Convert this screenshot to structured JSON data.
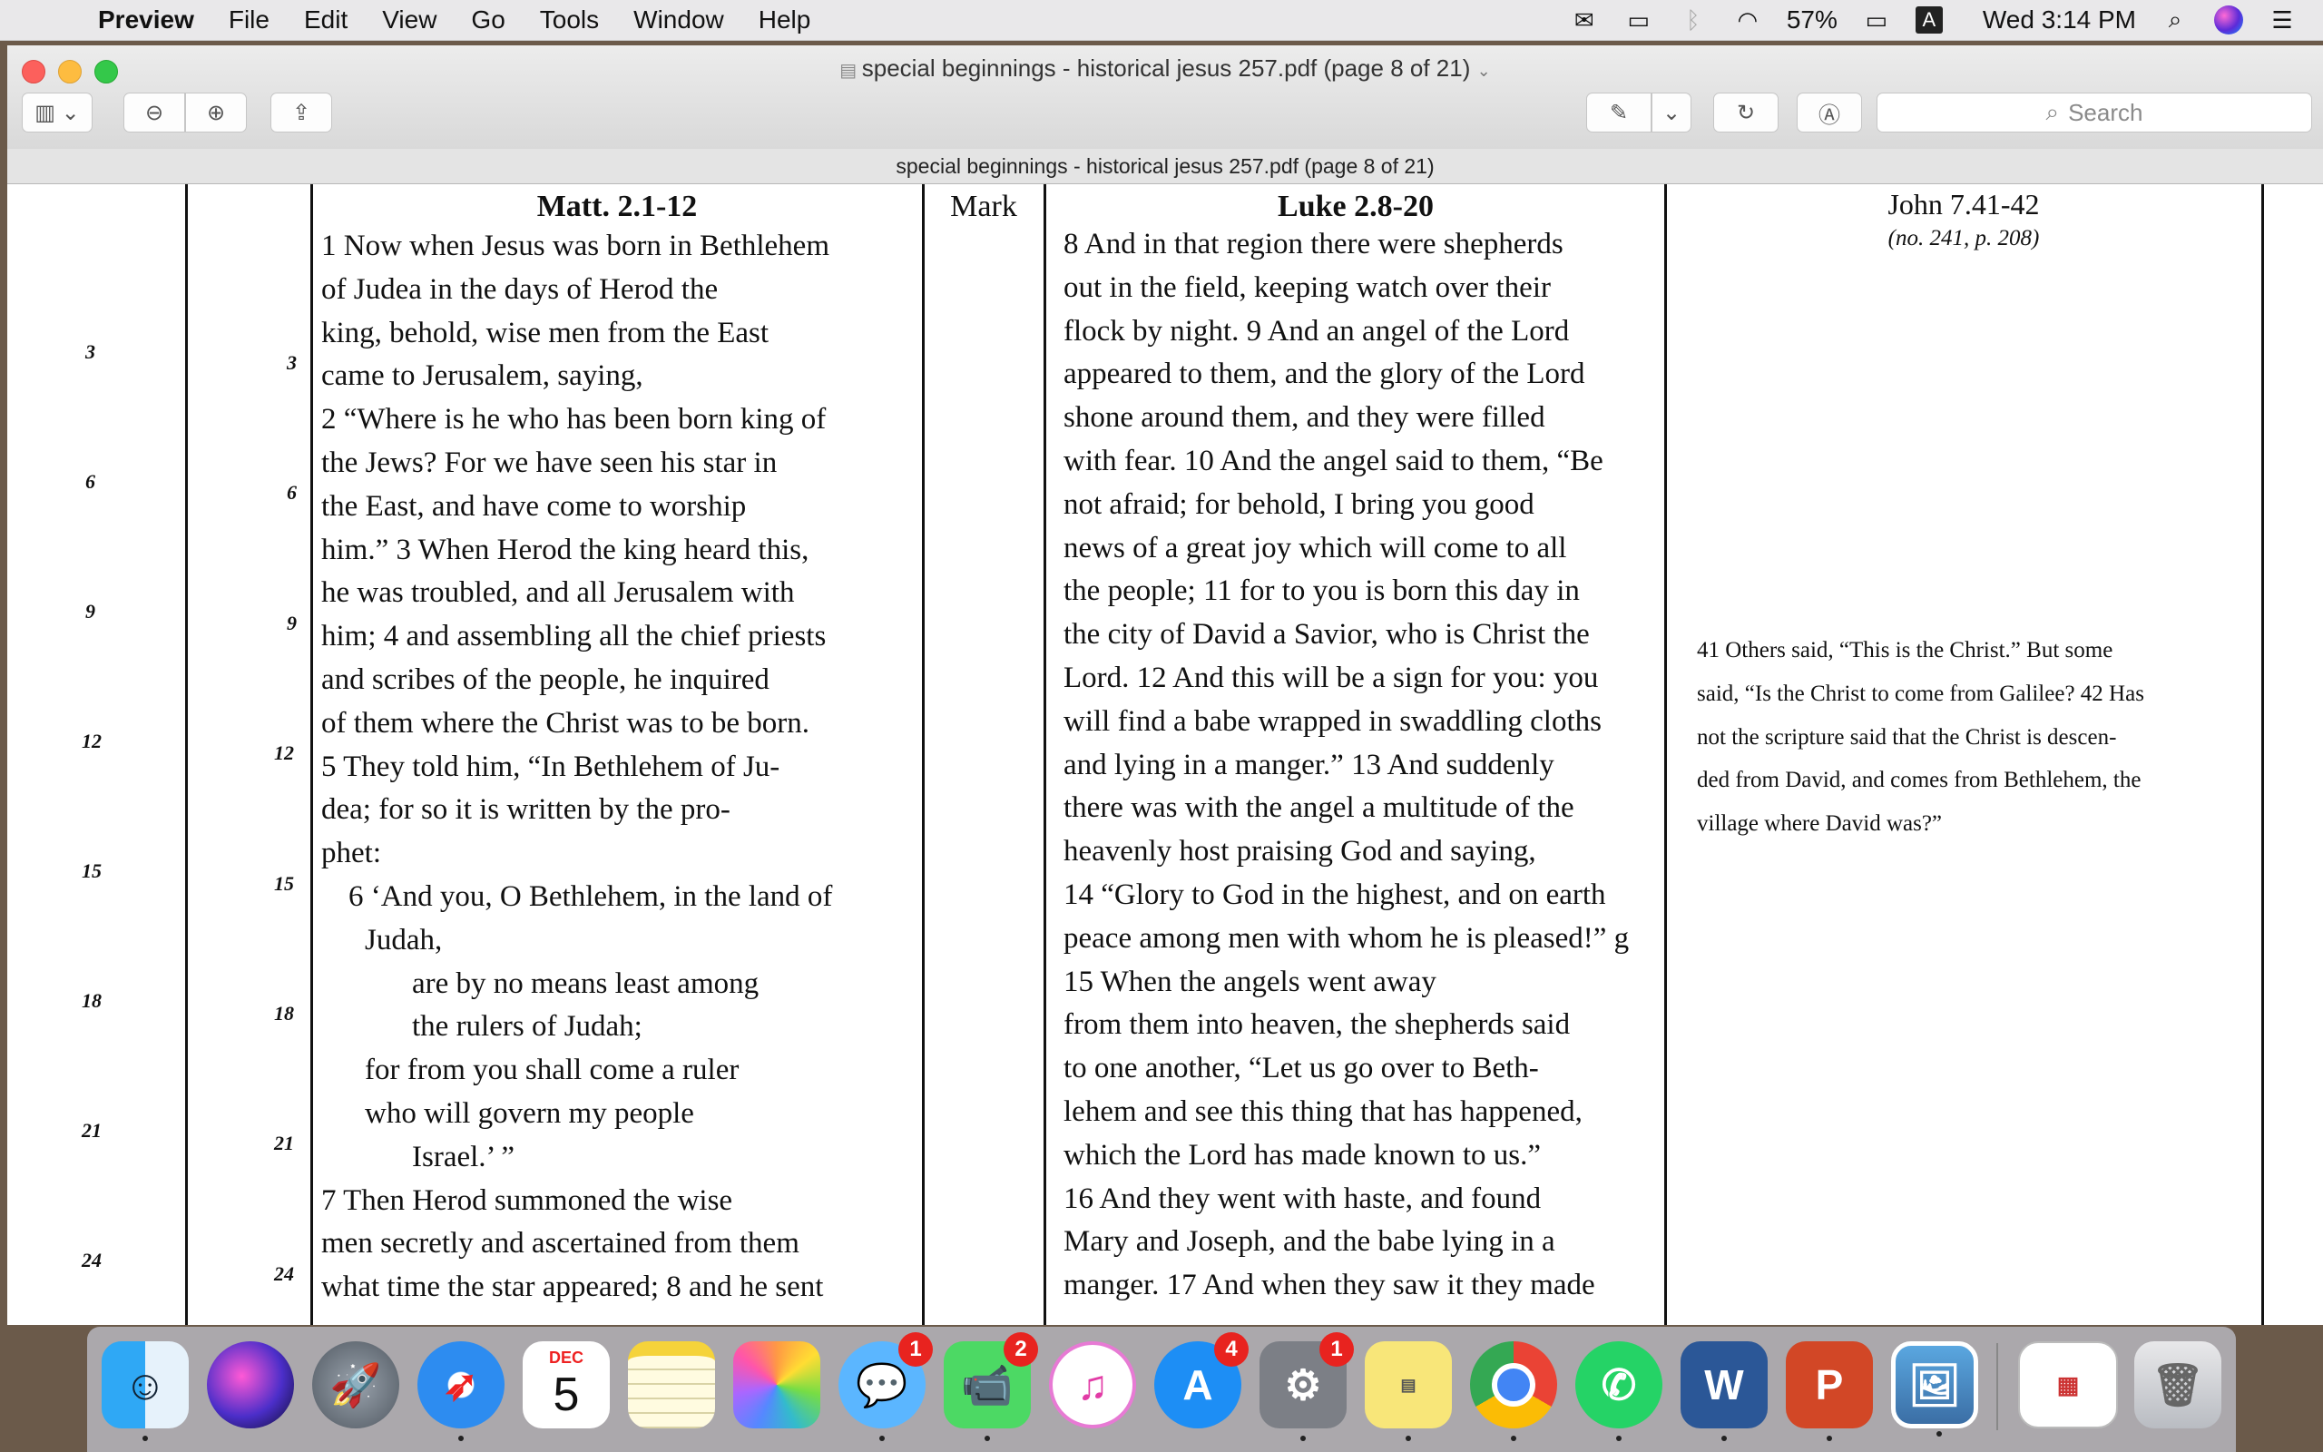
{
  "menubar": {
    "app": "Preview",
    "items": [
      "File",
      "Edit",
      "View",
      "Go",
      "Tools",
      "Window",
      "Help"
    ],
    "battery": "57%",
    "input_source": "A",
    "clock": "Wed 3:14 PM"
  },
  "window": {
    "title": "special beginnings - historical jesus 257.pdf (page 8 of 21)",
    "search_placeholder": "Search",
    "doc_title": "special beginnings - historical jesus 257.pdf (page 8 of 21)"
  },
  "page": {
    "headers": {
      "matt": "Matt. 2.1-12",
      "mark": "Mark",
      "luke": "Luke 2.8-20",
      "john": "John 7.41-42",
      "john_ref": "(no. 241, p. 208)"
    },
    "outer_numbers": [
      "3",
      "6",
      "9",
      "12",
      "15",
      "18",
      "21",
      "24"
    ],
    "inner_numbers": [
      "3",
      "6",
      "9",
      "12",
      "15",
      "18",
      "21",
      "24"
    ],
    "matt_lines": [
      "1 Now when Jesus was born in Bethlehem",
      "of Judea in the days of Herod the",
      "king, behold, wise men from the East",
      "came to Jerusalem, saying,",
      "2 “Where is he who has been born king of",
      "the Jews? For we have seen his star in",
      "the East, and have come to worship",
      "him.” 3 When Herod the king heard this,",
      "he was troubled, and all Jerusalem with",
      "him; 4 and assembling all the chief priests",
      "and scribes of the people, he inquired",
      "of them where the Christ was to be born.",
      "5 They told him, “In Bethlehem of Ju-",
      "dea; for so it is written by the pro-",
      "phet:",
      "6 ‘And you, O Bethlehem, in the land of",
      "Judah,",
      "are by no means least among",
      "the rulers of Judah;",
      "for from you shall come a ruler",
      "who will govern my people",
      "Israel.’ ”",
      "7 Then Herod summoned the wise",
      "men secretly and ascertained from them",
      "what time the star appeared; 8 and he sent"
    ],
    "luke_lines": [
      "8 And in that region there were shepherds",
      "out in the field, keeping watch over their",
      "flock by night. 9 And an angel of the Lord",
      "appeared to them, and the glory of the Lord",
      "shone around them, and they were filled",
      "with fear. 10 And the angel said to them, “Be",
      "not afraid; for behold, I bring you good",
      "news of a great joy which will come to all",
      "the people; 11 for to you is born this day in",
      "the city of David a Savior, who is Christ the",
      "Lord. 12 And this will be a sign for you: you",
      "will find a babe wrapped in swaddling cloths",
      "and lying in a manger.” 13 And suddenly",
      "there was with the angel a multitude of the",
      "heavenly host praising God and saying,",
      "14 “Glory to God in the highest, and on earth",
      "peace among men with whom he is pleased!” g",
      "15 When the angels went away",
      "from them into heaven, the shepherds said",
      "to one another, “Let us go over to Beth-",
      "lehem and see this thing that has happened,",
      "which the Lord has made known to us.”",
      "16 And they went with haste, and found",
      "Mary and Joseph, and the babe lying in a",
      "manger. 17 And when they saw it they made"
    ],
    "john_lines": [
      "41 Others said, “This is the Christ.” But some",
      "said, “Is the Christ to come from Galilee? 42 Has",
      "not the scripture said that the Christ is descen-",
      "ded from David, and comes from Bethlehem, the",
      "village where David was?”"
    ]
  },
  "dock": {
    "calendar_month": "DEC",
    "calendar_day": "5",
    "badges": {
      "messages": "1",
      "facetime": "2",
      "appstore": "4",
      "prefs": "1"
    },
    "apps": [
      "Finder",
      "Siri",
      "Launchpad",
      "Safari",
      "Calendar",
      "Notes",
      "Photos",
      "Messages",
      "FaceTime",
      "iTunes",
      "App Store",
      "System Preferences",
      "Stickies",
      "Chrome",
      "WhatsApp",
      "Word",
      "PowerPoint",
      "Preview",
      "Document",
      "Trash"
    ]
  }
}
